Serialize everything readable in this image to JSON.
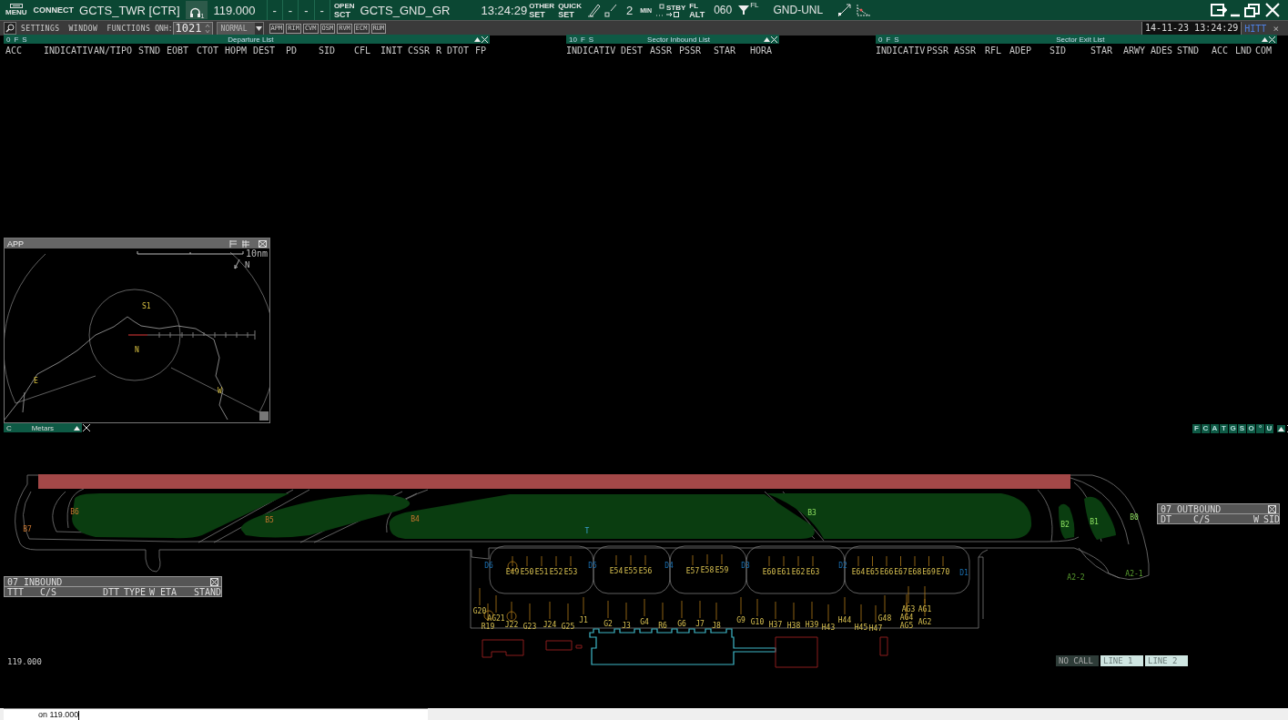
{
  "top_bar": {
    "menu": "MENU",
    "connect": "CONNECT",
    "position": "GCTS_TWR [CTR]",
    "headset_count": "1",
    "frequency": "119.000",
    "slots": [
      "-",
      "-",
      "-",
      "-"
    ],
    "open_sector": {
      "top": "OPEN",
      "bottom": "SCT"
    },
    "sector": "GCTS_GND_GR",
    "time": "13:24:29",
    "other_set": {
      "top": "OTHER",
      "bottom": "SET"
    },
    "quick_set": {
      "top": "QUICK",
      "bottom": "SET"
    },
    "count": "2",
    "min": "MIN",
    "stby": "STBY",
    "fl_alt": {
      "top": "FL",
      "bottom": "ALT"
    },
    "level": "060",
    "filter_tag": "FL",
    "limit": "GND-UNL"
  },
  "toolbar": {
    "menu_items": [
      "SETTINGS",
      "WINDOW",
      "FUNCTIONS"
    ],
    "qnh_label": "QNH:",
    "qnh": "1021",
    "mode": "NORMAL",
    "buttons": [
      "APM",
      "RIM",
      "CVM",
      "OSM",
      "RVM",
      "ECM",
      "RUM"
    ],
    "datetime": "14-11-23 13:24:29",
    "user": "HITT",
    "close": "×"
  },
  "lists": [
    {
      "title": "Departure List",
      "flags": [
        "0",
        "F",
        "S"
      ],
      "columns": [
        "ACC",
        "INDICATIV",
        "AN/TIPO",
        "STND",
        "EOBT",
        "CTOT",
        "HOPM",
        "DEST",
        "PD",
        "SID",
        "CFL",
        "INIT",
        "CSSR",
        "R",
        "DTOT",
        "FP"
      ]
    },
    {
      "title": "Sector Inbound List",
      "flags": [
        "10",
        "F",
        "S"
      ],
      "columns": [
        "INDICATIV",
        "DEST",
        "ASSR",
        "PSSR",
        "STAR",
        "HORA"
      ]
    },
    {
      "title": "Sector Exit List",
      "flags": [
        "0",
        "F",
        "S"
      ],
      "columns": [
        "INDICATIV",
        "PSSR",
        "ASSR",
        "RFL",
        "ADEP",
        "SID",
        "STAR",
        "ARWY",
        "ADES",
        "STND",
        "ACC",
        "LND",
        "COM"
      ]
    }
  ],
  "app_window": {
    "title": "APP",
    "scale": "10nm",
    "north": "N",
    "labels": [
      "S1",
      "N",
      "E",
      "W"
    ]
  },
  "metars_bar": {
    "flag": "C",
    "title": "Metars"
  },
  "filter_bar": {
    "letters": [
      "F",
      "C",
      "A",
      "T",
      "G",
      "S",
      "O",
      "°",
      "U"
    ]
  },
  "map": {
    "runway_exits": [
      "B7",
      "B6",
      "B5",
      "B4",
      "B3",
      "B2",
      "B1",
      "B0"
    ],
    "taxiway": "T",
    "holding_points": [
      "A2-2",
      "A2-1"
    ],
    "aprons": [
      "D6",
      "D5",
      "D4",
      "D3",
      "D2",
      "D1"
    ],
    "stands": [
      "E49",
      "E50",
      "E51",
      "E52",
      "E53",
      "E54",
      "E55",
      "E56",
      "E57",
      "E58",
      "E59",
      "E60",
      "E61",
      "E62",
      "E63",
      "E64",
      "E65",
      "E66",
      "E67",
      "E68",
      "E69",
      "E70",
      "G20",
      "AG21",
      "R19",
      "J22",
      "G23",
      "J24",
      "G25",
      "J1",
      "G2",
      "J3",
      "G4",
      "R6",
      "G6",
      "J7",
      "J8",
      "G9",
      "G10",
      "H37",
      "H38",
      "H39",
      "H43",
      "H44",
      "H45",
      "H47",
      "G48",
      "AG3",
      "AG1",
      "AG4",
      "AG5",
      "AG2"
    ]
  },
  "inbound": {
    "title": "07 INBOUND",
    "columns": [
      "TTT",
      "C/S",
      "DTT",
      "TYPE",
      "W",
      "ETA",
      "STAND"
    ]
  },
  "outbound": {
    "title": "07 OUTBOUND",
    "columns": [
      "DT",
      "C/S",
      "W",
      "SID"
    ]
  },
  "frequency_readout": "119.000",
  "call_lines": [
    {
      "label": "NO CALL",
      "enabled": false
    },
    {
      "label": "LINE 1",
      "enabled": true
    },
    {
      "label": "LINE 2",
      "enabled": true
    }
  ],
  "command_line": {
    "value": "on 119.000"
  }
}
